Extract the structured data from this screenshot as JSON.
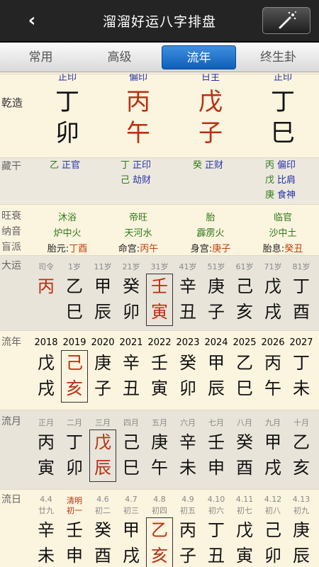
{
  "header": {
    "back": "‹",
    "title": "溜溜好运八字排盘",
    "wand": "magic-wand-icon"
  },
  "tabs": [
    "常用",
    "高级",
    "流年",
    "终生卦"
  ],
  "active_tab": 2,
  "shishen_top": [
    "正印",
    "偏印",
    "日主",
    "正印"
  ],
  "label_qz": "乾造",
  "tian": [
    "丁",
    "丙",
    "戊",
    "丁"
  ],
  "di": [
    "卯",
    "午",
    "子",
    "巳"
  ],
  "tian_color": [
    "blk",
    "red",
    "red",
    "blk"
  ],
  "di_color": [
    "blk",
    "red",
    "red",
    "blk"
  ],
  "label_cg": "藏干",
  "cg": [
    [
      [
        "乙",
        "正官"
      ]
    ],
    [
      [
        "丁",
        "正印"
      ],
      [
        "己",
        "劫财"
      ]
    ],
    [
      [
        "癸",
        "正财"
      ]
    ],
    [
      [
        "丙",
        "偏印"
      ],
      [
        "戊",
        "比肩"
      ],
      [
        "庚",
        "食神"
      ]
    ]
  ],
  "labels_info": [
    "旺衰",
    "纳音",
    "盲派"
  ],
  "wangshuai": [
    "沐浴",
    "帝旺",
    "胎",
    "临官"
  ],
  "nayin": [
    "炉中火",
    "天河水",
    "霹雳火",
    "沙中土"
  ],
  "mangpai": [
    [
      "胎元:",
      "丁酉"
    ],
    [
      "命宫:",
      "丙午"
    ],
    [
      "身宫:",
      "庚子"
    ],
    [
      "胎息:",
      "癸丑"
    ]
  ],
  "label_dy": "大运",
  "dy_age": [
    "司令",
    "1岁",
    "11岁",
    "21岁",
    "31岁",
    "41岁",
    "51岁",
    "61岁",
    "71岁",
    "81岁"
  ],
  "dy_t": [
    "丙",
    "乙",
    "甲",
    "癸",
    "壬",
    "辛",
    "庚",
    "己",
    "戊",
    "丁"
  ],
  "dy_d": [
    "",
    "巳",
    "辰",
    "卯",
    "寅",
    "丑",
    "子",
    "亥",
    "戌",
    "酉"
  ],
  "dy_hi": 4,
  "label_ln": "流年",
  "ln_year": [
    "2018",
    "2019",
    "2020",
    "2021",
    "2022",
    "2023",
    "2024",
    "2025",
    "2026",
    "2027"
  ],
  "ln_t": [
    "戊",
    "己",
    "庚",
    "辛",
    "壬",
    "癸",
    "甲",
    "乙",
    "丙",
    "丁"
  ],
  "ln_d": [
    "戌",
    "亥",
    "子",
    "丑",
    "寅",
    "卯",
    "辰",
    "巳",
    "午",
    "未"
  ],
  "ln_hi": 1,
  "label_ly": "流月",
  "ly_m": [
    "正月",
    "二月",
    "三月",
    "四月",
    "五月",
    "六月",
    "七月",
    "八月",
    "九月",
    "十月"
  ],
  "ly_t": [
    "丙",
    "丁",
    "戊",
    "己",
    "庚",
    "辛",
    "壬",
    "癸",
    "甲",
    "乙"
  ],
  "ly_d": [
    "寅",
    "卯",
    "辰",
    "巳",
    "午",
    "未",
    "申",
    "酉",
    "戌",
    "亥"
  ],
  "ly_hi": 2,
  "label_lr": "流日",
  "lr_d": [
    "4.4",
    "清明",
    "4.6",
    "4.7",
    "4.8",
    "4.9",
    "4.10",
    "4.11",
    "4.12",
    "4.13"
  ],
  "lr_l": [
    "廿九",
    "初一",
    "初二",
    "初三",
    "初四",
    "初五",
    "初六",
    "初七",
    "初八",
    "初九"
  ],
  "lr_t": [
    "辛",
    "壬",
    "癸",
    "甲",
    "乙",
    "丙",
    "丁",
    "戊",
    "己",
    "庚"
  ],
  "lr_z": [
    "未",
    "申",
    "酉",
    "戌",
    "亥",
    "子",
    "丑",
    "寅",
    "卯",
    "辰"
  ],
  "lr_hi": 4
}
